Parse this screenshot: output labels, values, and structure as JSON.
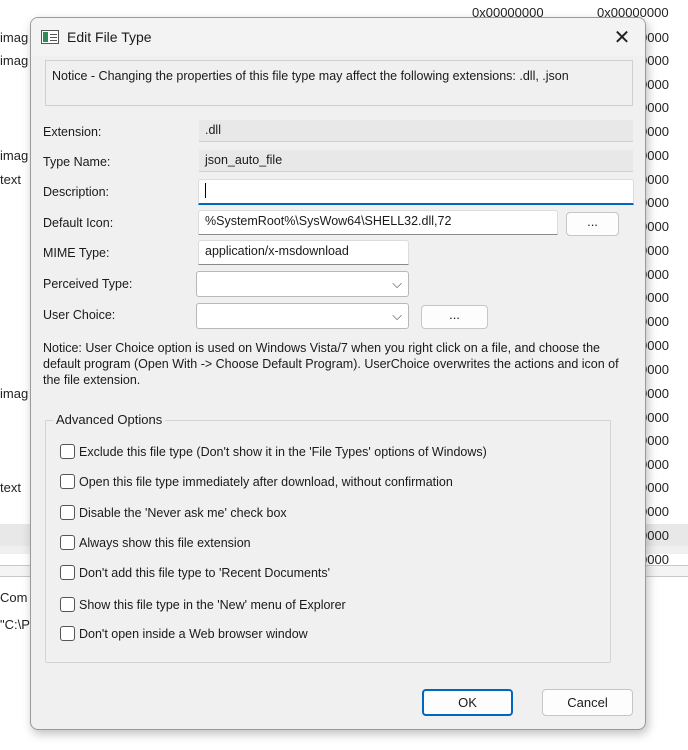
{
  "background": {
    "hex_col_a": "0x00000000",
    "hex_col_b": "0x00000000",
    "hex_partial": "0000",
    "left_image": "imag",
    "left_text": "text",
    "com": "Com",
    "path": "\"C:\\P"
  },
  "dialog": {
    "title": "Edit File Type",
    "close_glyph": "✕",
    "notice": "Notice - Changing the properties of this file type may affect the following extensions: .dll, .json",
    "fields": {
      "extension_label": "Extension:",
      "extension_value": ".dll",
      "type_name_label": "Type Name:",
      "type_name_value": "json_auto_file",
      "description_label": "Description:",
      "description_value": "",
      "default_icon_label": "Default Icon:",
      "default_icon_value": "%SystemRoot%\\SysWow64\\SHELL32.dll,72",
      "mime_label": "MIME Type:",
      "mime_value": "application/x-msdownload",
      "perceived_label": "Perceived Type:",
      "perceived_value": "",
      "user_choice_label": "User Choice:",
      "user_choice_value": "",
      "browse_label": "...",
      "chevron": "⌵"
    },
    "user_choice_notice": "Notice: User Choice option is used on Windows Vista/7 when you right click on a file, and choose the default program (Open With -> Choose Default Program). UserChoice overwrites the actions and icon of the file extension.",
    "advanced": {
      "title": "Advanced Options",
      "options": [
        {
          "label": "Exclude  this file type (Don't show it in the 'File Types' options of Windows)",
          "checked": false
        },
        {
          "label": "Open this file type immediately after download, without confirmation",
          "checked": false
        },
        {
          "label": "Disable the 'Never ask me' check box",
          "checked": false
        },
        {
          "label": "Always show this file extension",
          "checked": false
        },
        {
          "label": "Don't add this file type to 'Recent Documents'",
          "checked": false
        },
        {
          "label": "Show this file type in the 'New' menu of Explorer",
          "checked": false
        },
        {
          "label": "Don't open inside a Web browser window",
          "checked": false
        }
      ]
    },
    "ok_label": "OK",
    "cancel_label": "Cancel"
  },
  "colors": {
    "accent": "#0067c0",
    "dialog_bg": "#f0f0f0"
  }
}
